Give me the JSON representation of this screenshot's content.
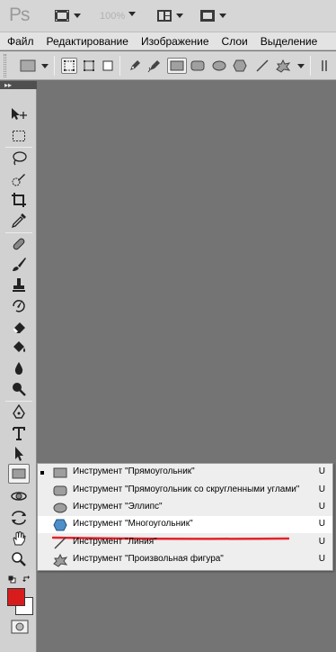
{
  "app": {
    "logo_text": "Ps",
    "zoom_text": "100%"
  },
  "menu": {
    "items": [
      {
        "label": "Файл"
      },
      {
        "label": "Редактирование"
      },
      {
        "label": "Изображение"
      },
      {
        "label": "Слои"
      },
      {
        "label": "Выделение"
      }
    ]
  },
  "options": {
    "icons": [
      "rectangle-preset-icon",
      "shape-layers-icon",
      "paths-icon",
      "fill-pixels-icon",
      "pen-icon",
      "freeform-pen-icon",
      "rectangle-icon",
      "rounded-rectangle-icon",
      "ellipse-icon",
      "polygon-icon",
      "line-icon",
      "custom-shape-icon"
    ],
    "selected": "rectangle-icon"
  },
  "toolbar": {
    "grip_label": "▸▸",
    "tools": [
      "move",
      "rectangular-marquee",
      "lasso",
      "quick-selection",
      "crop",
      "eyedropper",
      "spot-healing",
      "brush",
      "clone-stamp",
      "history-brush",
      "eraser",
      "paint-bucket",
      "blur",
      "dodge",
      "pen",
      "type",
      "path-selection",
      "rectangle",
      "3d-rotate",
      "3d-orbit",
      "hand",
      "zoom"
    ],
    "foreground_color": "#d81c1c",
    "background_color": "#ffffff"
  },
  "flyout": {
    "items": [
      {
        "icon": "rectangle-icon",
        "label": "Инструмент \"Прямоугольник\"",
        "shortcut": "U",
        "current": true,
        "highlighted": false
      },
      {
        "icon": "rounded-rectangle-icon",
        "label": "Инструмент \"Прямоугольник со скругленными углами\"",
        "shortcut": "U",
        "current": false,
        "highlighted": false
      },
      {
        "icon": "ellipse-icon",
        "label": "Инструмент \"Эллипс\"",
        "shortcut": "U",
        "current": false,
        "highlighted": false
      },
      {
        "icon": "polygon-icon",
        "label": "Инструмент \"Многоугольник\"",
        "shortcut": "U",
        "current": false,
        "highlighted": true
      },
      {
        "icon": "line-icon",
        "label": "Инструмент \"Линия\"",
        "shortcut": "U",
        "current": false,
        "highlighted": false
      },
      {
        "icon": "custom-shape-icon",
        "label": "Инструмент \"Произвольная фигура\"",
        "shortcut": "U",
        "current": false,
        "highlighted": false
      }
    ],
    "annotation_color": "#e3232b"
  }
}
